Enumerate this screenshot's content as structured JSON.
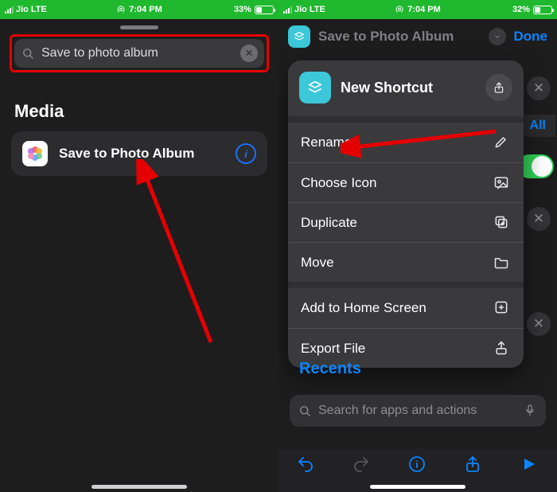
{
  "left": {
    "status": {
      "carrier": "Jio",
      "net": "LTE",
      "time": "7:04 PM",
      "battery": "33%"
    },
    "search": {
      "value": "Save to photo album"
    },
    "sectionTitle": "Media",
    "result": {
      "label": "Save to Photo Album"
    }
  },
  "right": {
    "status": {
      "carrier": "Jio",
      "net": "LTE",
      "time": "7:04 PM",
      "battery": "32%"
    },
    "topbar": {
      "title": "Save to Photo Album",
      "done": "Done"
    },
    "pillAll": "All",
    "sheet": {
      "title": "New Shortcut",
      "menu": {
        "rename": "Rename",
        "chooseIcon": "Choose Icon",
        "duplicate": "Duplicate",
        "move": "Move",
        "addToHome": "Add to Home Screen",
        "exportFile": "Export File"
      }
    },
    "recents": "Recents",
    "searchPlaceholder": "Search for apps and actions"
  }
}
